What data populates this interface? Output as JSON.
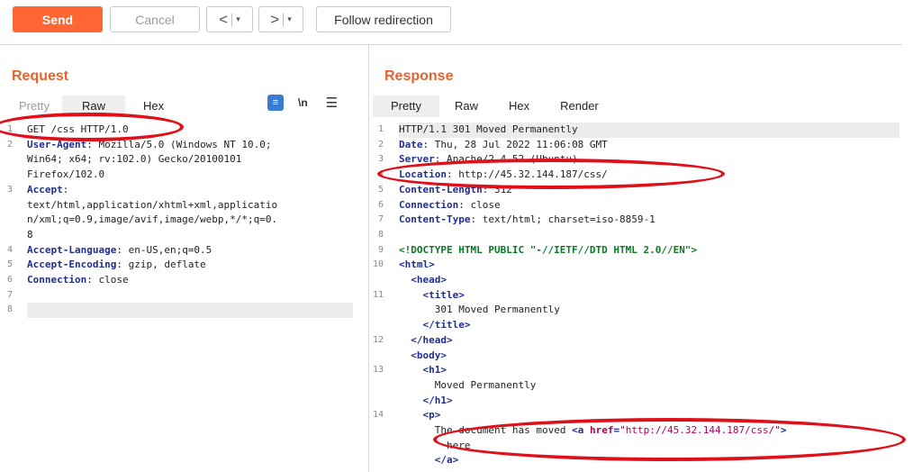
{
  "toolbar": {
    "send_label": "Send",
    "cancel_label": "Cancel",
    "back_arrow": "<",
    "forward_arrow": ">",
    "dropdown_glyph": "▾",
    "follow_label": "Follow redirection"
  },
  "request": {
    "title": "Request",
    "tabs": [
      {
        "label": "Pretty",
        "active": false
      },
      {
        "label": "Raw",
        "active": true
      },
      {
        "label": "Hex",
        "active": false
      }
    ],
    "tools": {
      "wrap_icon": "text-wrap-icon",
      "newline_label": "\\n",
      "menu_icon": "hamburger-menu-icon"
    },
    "lines": [
      {
        "num": "1",
        "text": "GET /css HTTP/1.0"
      },
      {
        "num": "2",
        "key": "User-Agent",
        "text": ": Mozilla/5.0 (Windows NT 10.0;"
      },
      {
        "num": "",
        "text": "Win64; x64; rv:102.0) Gecko/20100101"
      },
      {
        "num": "",
        "text": "Firefox/102.0"
      },
      {
        "num": "3",
        "key": "Accept",
        "text": ":"
      },
      {
        "num": "",
        "text": "text/html,application/xhtml+xml,applicatio"
      },
      {
        "num": "",
        "text": "n/xml;q=0.9,image/avif,image/webp,*/*;q=0."
      },
      {
        "num": "",
        "text": "8"
      },
      {
        "num": "4",
        "key": "Accept-Language",
        "text": ": en-US,en;q=0.5"
      },
      {
        "num": "5",
        "key": "Accept-Encoding",
        "text": ": gzip, deflate"
      },
      {
        "num": "6",
        "key": "Connection",
        "text": ": close"
      },
      {
        "num": "7",
        "text": ""
      },
      {
        "num": "8",
        "text": ""
      }
    ]
  },
  "response": {
    "title": "Response",
    "tabs": [
      {
        "label": "Pretty",
        "active": true
      },
      {
        "label": "Raw",
        "active": false
      },
      {
        "label": "Hex",
        "active": false
      },
      {
        "label": "Render",
        "active": false
      }
    ],
    "lines": [
      {
        "num": "1",
        "text": "HTTP/1.1 301 Moved Permanently"
      },
      {
        "num": "2",
        "key": "Date",
        "text": ": Thu, 28 Jul 2022 11:06:08 GMT"
      },
      {
        "num": "3",
        "key": "Server",
        "text": ": Apache/2.4.52 (Ubuntu)"
      },
      {
        "num": "4",
        "key": "Location",
        "text": ": http://45.32.144.187/css/"
      },
      {
        "num": "5",
        "key": "Content-Length",
        "text": ": 312"
      },
      {
        "num": "6",
        "key": "Connection",
        "text": ": close"
      },
      {
        "num": "7",
        "key": "Content-Type",
        "text": ": text/html; charset=iso-8859-1"
      },
      {
        "num": "8",
        "text": ""
      },
      {
        "num": "9",
        "doctype": "<!DOCTYPE HTML PUBLIC \"-//IETF//DTD HTML 2.0//EN\">"
      },
      {
        "num": "10",
        "tag": "<html>"
      },
      {
        "num": "",
        "indent": "  ",
        "tag": "<head>"
      },
      {
        "num": "11",
        "indent": "    ",
        "tag": "<title>"
      },
      {
        "num": "",
        "indent": "      ",
        "text": "301 Moved Permanently"
      },
      {
        "num": "",
        "indent": "    ",
        "tag": "</title>"
      },
      {
        "num": "12",
        "indent": "  ",
        "tag": "</head>"
      },
      {
        "num": "",
        "indent": "  ",
        "tag": "<body>"
      },
      {
        "num": "13",
        "indent": "    ",
        "tag": "<h1>"
      },
      {
        "num": "",
        "indent": "      ",
        "text": "Moved Permanently"
      },
      {
        "num": "",
        "indent": "    ",
        "tag": "</h1>"
      },
      {
        "num": "14",
        "indent": "    ",
        "tag": "<p>"
      },
      {
        "num": "",
        "indent": "      ",
        "text": "The document has moved ",
        "tag2": "<a ",
        "attr": "href",
        "tag3": "=",
        "str": "\"http://45.32.144.187/css/\"",
        "tag4": ">"
      },
      {
        "num": "",
        "indent": "        ",
        "text": "here"
      },
      {
        "num": "",
        "indent": "      ",
        "tag": "</a>"
      }
    ]
  },
  "annotation_color": "#e0101a"
}
